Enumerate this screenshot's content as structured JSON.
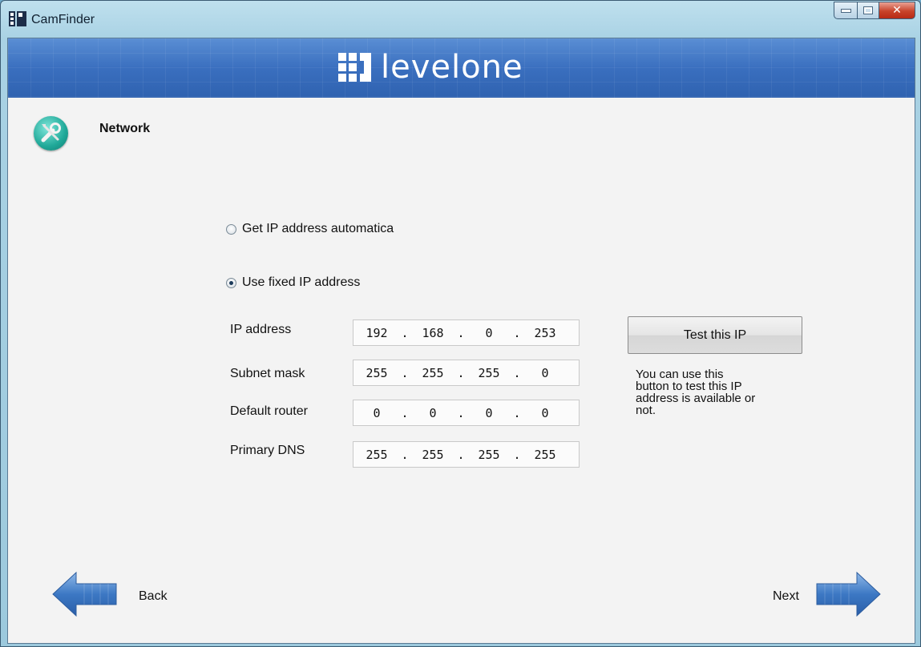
{
  "window": {
    "title": "CamFinder",
    "controls": {
      "minimize": "minimize-icon",
      "maximize": "maximize-icon",
      "close": "close-icon"
    }
  },
  "banner": {
    "logo_text": "levelone"
  },
  "section": {
    "title": "Network",
    "icon": "tools-icon"
  },
  "ip_mode": {
    "auto_label": "Get IP address automatica",
    "fixed_label": "Use fixed IP address",
    "selected": "fixed"
  },
  "fields": [
    {
      "label": "IP address",
      "octets": [
        "192",
        "168",
        "0",
        "253"
      ]
    },
    {
      "label": "Subnet mask",
      "octets": [
        "255",
        "255",
        "255",
        "0"
      ]
    },
    {
      "label": "Default router",
      "octets": [
        "0",
        "0",
        "0",
        "0"
      ]
    },
    {
      "label": "Primary DNS",
      "octets": [
        "255",
        "255",
        "255",
        "255"
      ]
    }
  ],
  "test": {
    "button_label": "Test this IP",
    "hint_lines": [
      "You can use this",
      "button to test this IP",
      "address is available or",
      "not."
    ]
  },
  "nav": {
    "back_label": "Back",
    "next_label": "Next"
  },
  "colors": {
    "banner": "#3a6fbf",
    "arrow": "#3c78c4",
    "window_frame": "#a9d2e4"
  }
}
